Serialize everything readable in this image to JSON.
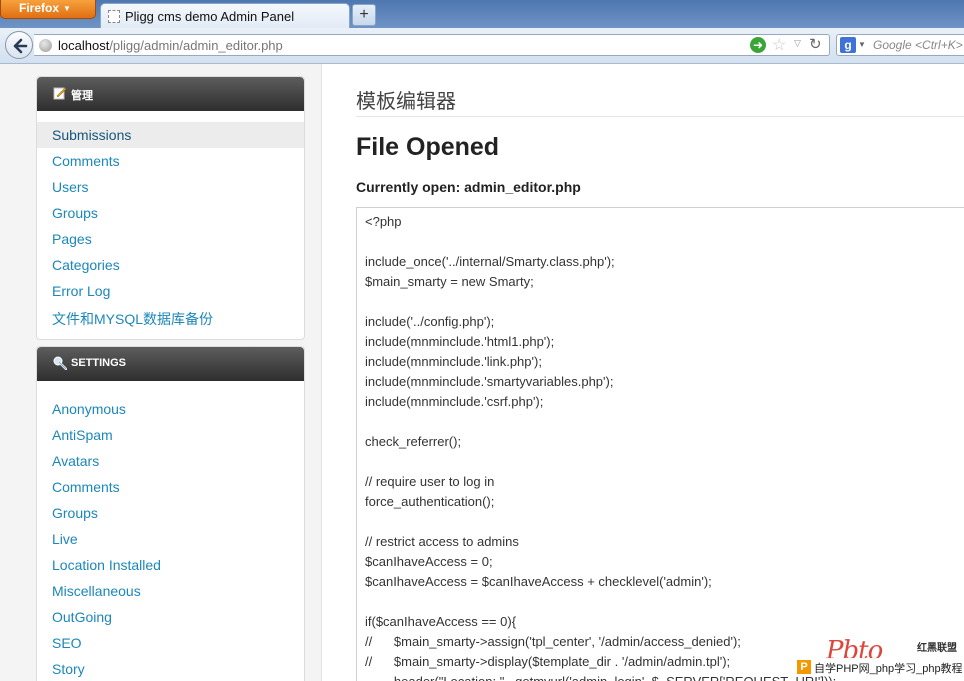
{
  "browser": {
    "menu_button": "Firefox",
    "tab_title": "Pligg cms demo Admin Panel",
    "new_tab": "+",
    "url_host": "localhost",
    "url_path": "/pligg/admin/admin_editor.php",
    "search_placeholder": "Google <Ctrl+K>",
    "search_engine_letter": "g",
    "icons": [
      "back-arrow-icon",
      "globe-icon",
      "go-icon",
      "star-icon",
      "reload-icon",
      "google-icon"
    ]
  },
  "sidebar": {
    "manage": {
      "title": "管理",
      "items": [
        "Submissions",
        "Comments",
        "Users",
        "Groups",
        "Pages",
        "Categories",
        "Error Log",
        "文件和MYSQL数据库备份"
      ],
      "active": "Submissions"
    },
    "settings": {
      "title": "SETTINGS",
      "items": [
        "Anonymous",
        "AntiSpam",
        "Avatars",
        "Comments",
        "Groups",
        "Live",
        "Location Installed",
        "Miscellaneous",
        "OutGoing",
        "SEO",
        "Story"
      ]
    }
  },
  "main": {
    "page_title": "模板编辑器",
    "heading": "File Opened",
    "current_file": "Currently open: admin_editor.php",
    "code": "<?php\n\ninclude_once('../internal/Smarty.class.php');\n$main_smarty = new Smarty;\n\ninclude('../config.php');\ninclude(mnminclude.'html1.php');\ninclude(mnminclude.'link.php');\ninclude(mnminclude.'smartyvariables.php');\ninclude(mnminclude.'csrf.php');\n\ncheck_referrer();\n\n// require user to log in\nforce_authentication();\n\n// restrict access to admins\n$canIhaveAccess = 0;\n$canIhaveAccess = $canIhaveAccess + checklevel('admin');\n\nif($canIhaveAccess == 0){\n//      $main_smarty->assign('tpl_center', '/admin/access_denied');\n//      $main_smarty->display($template_dir . '/admin/admin.tpl');\n        header(\"Location: \" . getmyurl('admin_login', $_SERVER['REQUEST_URI']));"
  },
  "watermark": {
    "logo": "Pbto",
    "brand": "红黑联盟",
    "bar_text": "自学PHP网_php学习_php教程",
    "p_letter": "P"
  },
  "colors": {
    "link": "#1c87b9",
    "panel_header": "#3a3a3a",
    "active_item_bg": "#ececec"
  }
}
